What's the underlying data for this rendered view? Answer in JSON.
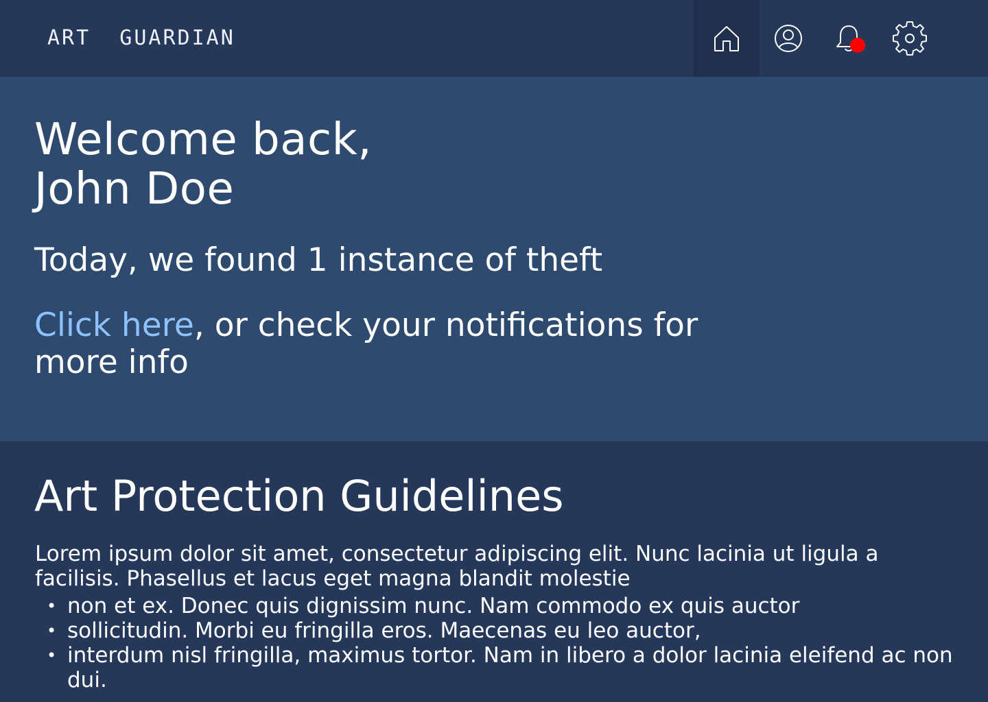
{
  "header": {
    "brand": "ART  GUARDIAN",
    "nav": [
      {
        "icon": "home-icon",
        "active": true
      },
      {
        "icon": "user-icon",
        "active": false
      },
      {
        "icon": "bell-icon",
        "active": false,
        "has_badge": true
      },
      {
        "icon": "gear-icon",
        "active": false
      }
    ],
    "badge_color": "#ff0000"
  },
  "hero": {
    "welcome_line1": "Welcome back,",
    "welcome_line2": "John Doe",
    "theft_message": "Today, we found 1 instance of theft",
    "link_text": "Click here",
    "link_suffix": ", or check your notifications for more info"
  },
  "guidelines": {
    "title": "Art Protection Guidelines",
    "intro": "Lorem ipsum dolor sit amet, consectetur adipiscing elit. Nunc lacinia ut ligula a facilisis. Phasellus et lacus eget magna blandit molestie",
    "items": [
      "non et ex. Donec quis dignissim nunc. Nam commodo ex quis auctor",
      "sollicitudin. Morbi eu fringilla eros. Maecenas eu leo auctor,",
      "interdum nisl fringilla, maximus tortor. Nam in libero a dolor lacinia eleifend ac non dui."
    ]
  },
  "colors": {
    "header_bg": "#263859",
    "hero_bg": "#2e4a6f",
    "link": "#8ec2ff",
    "active_nav_bg": "#1f2f4d"
  }
}
